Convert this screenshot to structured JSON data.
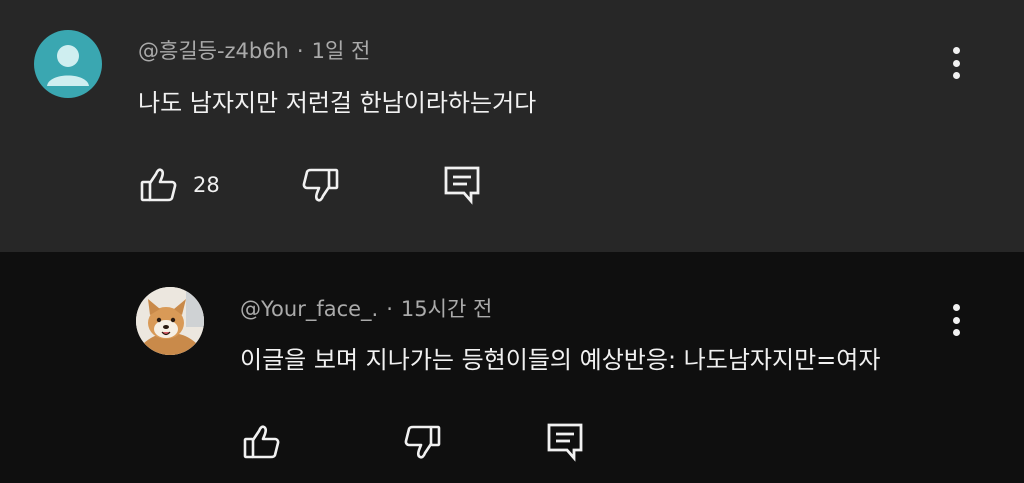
{
  "comments": [
    {
      "author": "@흥길등-z4b6h",
      "time": "1일 전",
      "text": "나도 남자지만 저런걸 한남이라하는거다",
      "likes": "28",
      "avatar_icon": "default-person-avatar"
    },
    {
      "author": "@Your_face_.",
      "time": "15시간 전",
      "text": "이글을 보며 지나가는 등현이들의 예상반응: 나도남자지만=여자",
      "avatar_icon": "shiba-dog-avatar"
    }
  ],
  "separator": "·",
  "icons": {
    "like": "thumbs-up-icon",
    "dislike": "thumbs-down-icon",
    "reply": "reply-comment-icon",
    "more": "more-vertical-icon"
  },
  "colors": {
    "top_background": "#272727",
    "reply_background": "#0f0f0f",
    "avatar_teal": "#3aa7b1",
    "meta_text": "#aaaaaa",
    "main_text": "#f1f1f1"
  }
}
